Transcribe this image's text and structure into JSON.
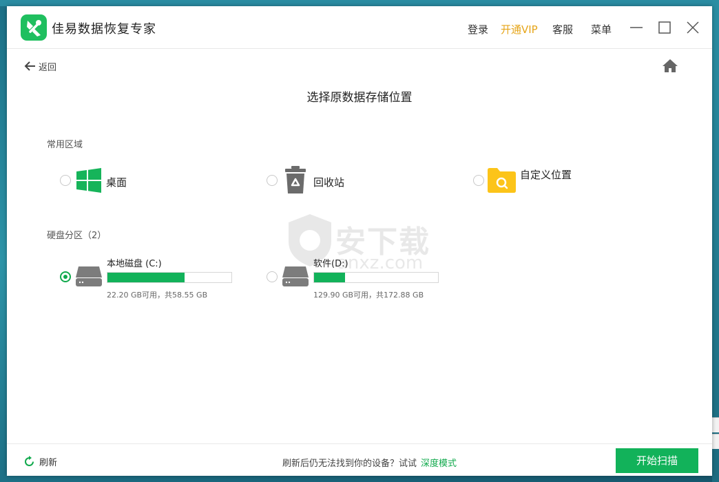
{
  "app": {
    "title": "佳易数据恢复专家"
  },
  "titlebar": {
    "login": "登录",
    "vip": "开通VIP",
    "service": "客服",
    "menu": "菜单",
    "vip_color": "#e6a519"
  },
  "nav": {
    "back_label": "返回"
  },
  "page": {
    "title": "选择原数据存储位置"
  },
  "common_section": {
    "label": "常用区域",
    "items": [
      {
        "label": "桌面",
        "icon": "windows-icon",
        "checked": false
      },
      {
        "label": "回收站",
        "icon": "recycle-bin-icon",
        "checked": false
      },
      {
        "label": "自定义位置",
        "icon": "folder-search-icon",
        "checked": false
      }
    ]
  },
  "disk_section": {
    "label": "硬盘分区（2）",
    "drives": [
      {
        "name": "本地磁盘 (C:)",
        "free_text": "22.20 GB可用，共58.55 GB",
        "used_fraction": 0.62,
        "checked": true
      },
      {
        "name": "软件(D:)",
        "free_text": "129.90 GB可用，共172.88 GB",
        "used_fraction": 0.25,
        "checked": false
      }
    ]
  },
  "watermark": {
    "text": "安下载",
    "sub": "anxz.com"
  },
  "footer": {
    "refresh_label": "刷新",
    "hint": "刷新后仍无法找到你的设备？试试",
    "deep_mode": "深度模式",
    "scan_button": "开始扫描"
  },
  "colors": {
    "accent": "#12b25a",
    "vip": "#e6a519"
  }
}
